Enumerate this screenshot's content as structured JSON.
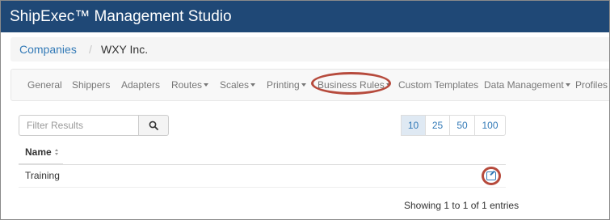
{
  "app": {
    "title": "ShipExec™ Management Studio"
  },
  "breadcrumb": {
    "parent": "Companies",
    "separator": "/",
    "current": "WXY Inc."
  },
  "nav": {
    "items": [
      {
        "label": "General",
        "dropdown": false
      },
      {
        "label": "Shippers",
        "dropdown": false
      },
      {
        "label": "Adapters",
        "dropdown": false
      },
      {
        "label": "Routes",
        "dropdown": true
      },
      {
        "label": "Scales",
        "dropdown": true
      },
      {
        "label": "Printing",
        "dropdown": true
      },
      {
        "label": "Business Rules",
        "dropdown": true,
        "highlighted": true
      },
      {
        "label": "Custom Templates",
        "dropdown": false
      },
      {
        "label": "Data Management",
        "dropdown": true
      },
      {
        "label": "Profiles",
        "dropdown": false
      }
    ]
  },
  "filter": {
    "placeholder": "Filter Results",
    "value": "",
    "icon": "search-icon"
  },
  "page_size": {
    "options": [
      "10",
      "25",
      "50",
      "100"
    ],
    "selected": "10"
  },
  "table": {
    "columns": [
      {
        "label": "Name",
        "sortable": true
      }
    ],
    "rows": [
      {
        "name": "Training",
        "action_icon": "edit-icon"
      }
    ]
  },
  "info": {
    "text": "Showing 1 to 1 of 1 entries"
  },
  "colors": {
    "header_bg": "#1f4876",
    "link": "#337ab7",
    "highlight_ring": "#b64a3c"
  }
}
